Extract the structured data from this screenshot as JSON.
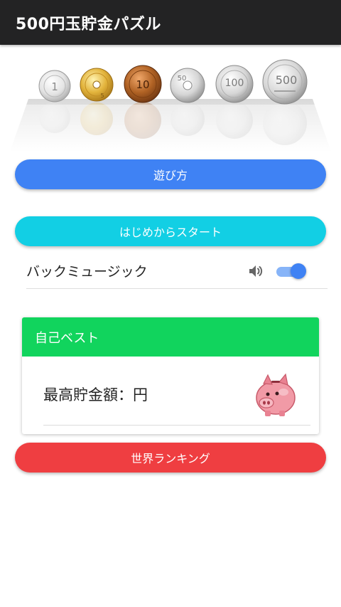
{
  "app_bar": {
    "title": "500円玉貯金パズル"
  },
  "coins": [
    {
      "name": "coin-1-yen",
      "label": "1"
    },
    {
      "name": "coin-5-yen",
      "label": "5"
    },
    {
      "name": "coin-10-yen",
      "label": "10"
    },
    {
      "name": "coin-50-yen",
      "label": "50"
    },
    {
      "name": "coin-100-yen",
      "label": "100"
    },
    {
      "name": "coin-500-yen",
      "label": "500"
    }
  ],
  "buttons": {
    "how_to_play": "遊び方",
    "start": "はじめからスタート",
    "ranking": "世界ランキング"
  },
  "music": {
    "label": "バックミュージック",
    "icon": "speaker-icon",
    "enabled": true
  },
  "best": {
    "header": "自己ベスト",
    "savings_label": "最高貯金額：円",
    "icon": "piggy-bank-icon"
  },
  "colors": {
    "app_bar": "#232324",
    "how_to_play": "#3f82f4",
    "start": "#12cfe4",
    "ranking": "#ef3e41",
    "best_header": "#11d45d",
    "toggle_on": "#3f82f4"
  }
}
